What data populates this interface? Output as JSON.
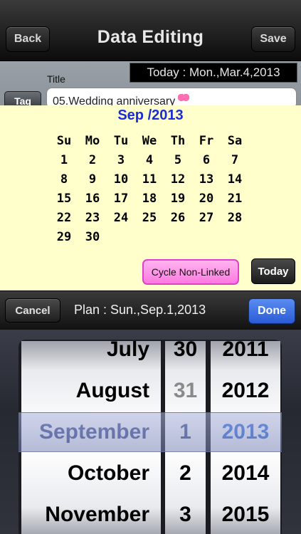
{
  "nav": {
    "back_label": "Back",
    "title": "Data Editing",
    "save_label": "Save"
  },
  "form": {
    "today_text": "Today : Mon.,Mar.4,2013",
    "title_label": "Title",
    "tag_label": "Tag",
    "title_value": "05.Wedding anniversary"
  },
  "calendar": {
    "month_label": "Sep /2013",
    "weekdays": [
      "Su",
      "Mo",
      "Tu",
      "We",
      "Th",
      "Fr",
      "Sa"
    ],
    "weeks": [
      [
        "",
        "1",
        "2",
        "3",
        "4",
        "5",
        "6",
        "7"
      ],
      [
        "8",
        "9",
        "10",
        "11",
        "12",
        "13",
        "14"
      ],
      [
        "15",
        "16",
        "17",
        "18",
        "19",
        "20",
        "21"
      ],
      [
        "22",
        "23",
        "24",
        "25",
        "26",
        "27",
        "28"
      ],
      [
        "29",
        "30",
        "",
        "",
        "",
        "",
        ""
      ]
    ],
    "cycle_label": "Cycle Non-Linked",
    "today_label": "Today"
  },
  "picker_toolbar": {
    "cancel_label": "Cancel",
    "plan_text": "Plan : Sun.,Sep.1,2013",
    "done_label": "Done"
  },
  "picker": {
    "months": [
      "July",
      "August",
      "September",
      "October",
      "November"
    ],
    "days": [
      "30",
      "31",
      "1",
      "2",
      "3"
    ],
    "years": [
      "2011",
      "2012",
      "2013",
      "2014",
      "2015"
    ],
    "selected_index": 2
  }
}
